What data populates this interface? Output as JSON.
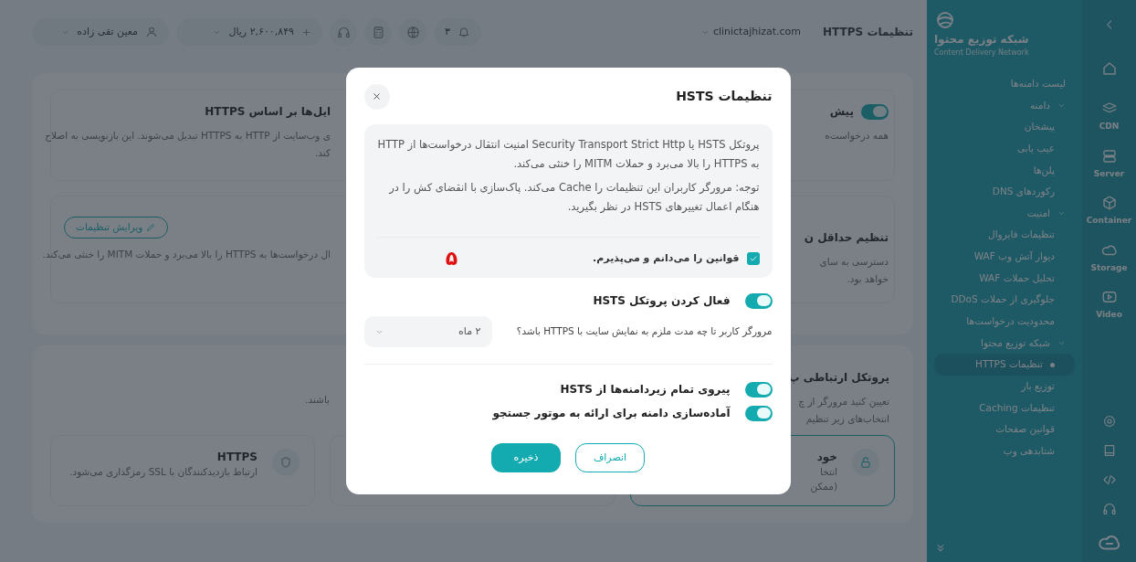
{
  "topbar": {
    "title": "تنظیمات HTTPS",
    "domain": "clinictajhizat.com",
    "notification_count": "۳",
    "balance": "۲,۶۰۰,۸۴۹",
    "currency": "ریال",
    "user": "معین تقی زاده"
  },
  "content": {
    "sections": [
      {
        "right": {
          "title": "پیش",
          "toggle_on": true,
          "lines": [
            "همه درخواست‌ه"
          ]
        },
        "left": {
          "title": "ایل‌ها بر اساس HTTPS",
          "lines": [
            "ی وب‌سایت از HTTP به HTTPS تبدیل می‌شوند. این بازنویسی به اصلاح",
            "کند."
          ]
        }
      },
      {
        "right": {
          "title": "تنظیم حداقل ن",
          "lines": [
            "دسترسی به سای",
            "خواهد بود."
          ]
        },
        "left": {
          "button": "ویرایش تنظیمات",
          "lines": [
            "ال درخواست‌ها به HTTPS را بالا می‌برد و حملات MITM را خنثی می‌کند."
          ]
        }
      }
    ],
    "protocol": {
      "title": "پروتکل ارتباطی پ",
      "lines": [
        "تعیین کنید مرورگر از چ",
        "انتخاب‌های زیر تنظیم"
      ],
      "left_line": "باشند.",
      "options": [
        {
          "title": "خود",
          "lines": [
            "انتخا",
            "(ممکن"
          ],
          "selected": true
        },
        {
          "title": "HTTPS",
          "lines": [
            "ارتباط بازدیدکنندگان با SSL رمزگذاری می‌شود."
          ],
          "selected": false
        }
      ]
    }
  },
  "sidebar": {
    "title": "شبکه توزیع محتوا",
    "subtitle": "Content Delivery Network",
    "rail_items": [
      {
        "label": "CDN"
      },
      {
        "label": "Server"
      },
      {
        "label": "Container"
      },
      {
        "label": "Storage"
      },
      {
        "label": "Video"
      }
    ],
    "items": [
      {
        "label": "لیست دامنه‌ها",
        "selected": false
      },
      {
        "label": "دامنه",
        "selected": false,
        "expanded": true,
        "children": [
          {
            "label": "پیشخان",
            "selected": false
          },
          {
            "label": "عیب یابی",
            "selected": false
          },
          {
            "label": "پلن‌ها",
            "selected": false
          },
          {
            "label": "رکوردهای DNS",
            "selected": false
          }
        ]
      },
      {
        "label": "امنیت",
        "selected": false,
        "expanded": true,
        "children": [
          {
            "label": "تنظیمات فایروال",
            "selected": false
          },
          {
            "label": "دیوار آتش وب WAF",
            "selected": false
          },
          {
            "label": "تحلیل حملات WAF",
            "selected": false
          },
          {
            "label": "جلوگیری از حملات DDoS",
            "selected": false
          },
          {
            "label": "محدودیت درخواست‌ها",
            "selected": false
          }
        ]
      },
      {
        "label": "شبکه توزیع محتوا",
        "selected": false,
        "expanded": true,
        "children": [
          {
            "label": "تنظیمات HTTPS",
            "selected": true
          },
          {
            "label": "توزیع بار",
            "selected": false
          },
          {
            "label": "تنظیمات Caching",
            "selected": false
          },
          {
            "label": "قوانین صفحات",
            "selected": false
          },
          {
            "label": "شتابدهی وب",
            "selected": false
          }
        ]
      }
    ]
  },
  "modal": {
    "title": "تنظیمات HSTS",
    "info": [
      "پروتکل HSTS یا Security Transport Strict Http امنیت انتقال درخواست‌ها از HTTP به HTTPS را بالا می‌برد و حملات MITM را خنثی می‌کند.",
      "توجه: مرورگر کاربران این تنظیمات را Cache می‌کند. پاک‌سازی با انقضای کش را در هنگام اعمال تغییرهای HSTS در نظر بگیرید."
    ],
    "agree": {
      "label": "قوانین را می‌دانم و می‌پذیرم.",
      "checked": true
    },
    "annotation": "۵",
    "enable": {
      "label": "فعال کردن پروتکل HSTS",
      "on": true
    },
    "duration": {
      "label": "مرورگر کاربر تا چه مدت ملزم به نمایش سایت با HTTPS باشد؟",
      "value": "۲ ماه"
    },
    "toggles": [
      {
        "label": "پیروی تمام زیردامنه‌ها از HSTS",
        "on": true
      },
      {
        "label": "آماده‌سازی دامنه برای ارائه به موتور جستجو",
        "on": true
      }
    ],
    "buttons": [
      {
        "label": "انصراف",
        "kind": "secondary"
      },
      {
        "label": "ذخیره",
        "kind": "primary"
      }
    ]
  }
}
